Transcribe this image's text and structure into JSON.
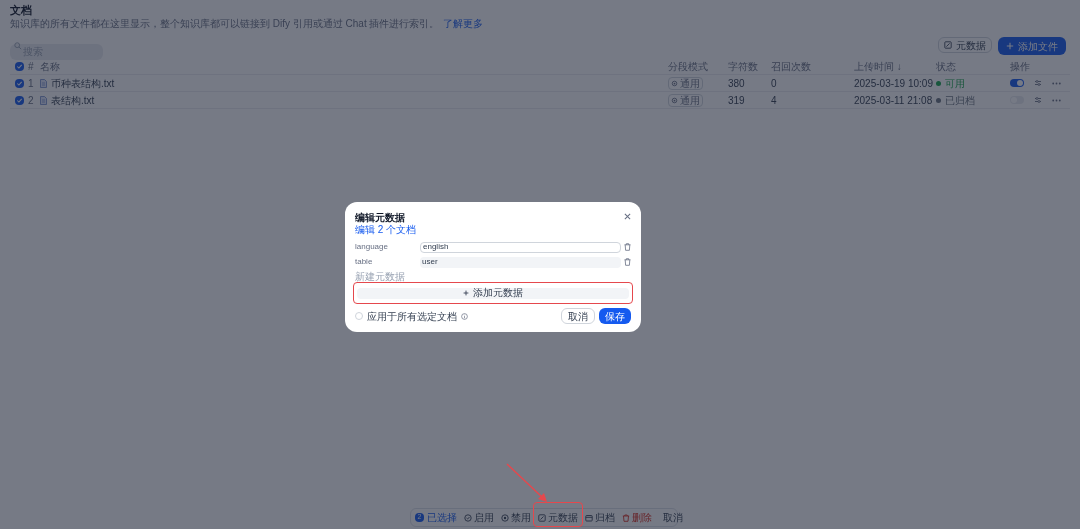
{
  "header": {
    "title": "文档",
    "description": "知识库的所有文件都在这里显示，整个知识库都可以链接到 Dify 引用或通过 Chat 插件进行索引。",
    "learn_more": "了解更多"
  },
  "search": {
    "placeholder": "搜索"
  },
  "toolbar": {
    "metadata_button": "元数据",
    "add_button": "添加文件"
  },
  "table": {
    "all_checked": true,
    "columns": [
      "#",
      "名称",
      "分段模式",
      "字符数",
      "召回次数",
      "上传时间 ↓",
      "状态",
      "操作"
    ],
    "rows": [
      {
        "checked": true,
        "index": "1",
        "name": "币种表结构.txt",
        "mode": "通用",
        "chars": "380",
        "recalls": "0",
        "uploaded": "2025-03-19 10:09",
        "status": "可用",
        "color": "#18563c",
        "enabled": true
      },
      {
        "checked": true,
        "index": "2",
        "name": "表结构.txt",
        "mode": "通用",
        "chars": "319",
        "recalls": "4",
        "uploaded": "2025-03-11 21:08",
        "status": "已归档",
        "color": "#3a4252",
        "enabled": false
      }
    ]
  },
  "modal": {
    "title": "编辑元数据",
    "subtitle": "编辑 2 个文档",
    "fields": [
      {
        "key": "language",
        "value": "english",
        "focused": true
      },
      {
        "key": "table",
        "value": "user",
        "focused": false
      }
    ],
    "new_label": "新建元数据",
    "add_button": "添加元数据",
    "apply_all": {
      "label": "应用于所有选定文档",
      "checked": false
    },
    "cancel": "取消",
    "save": "保存"
  },
  "selection_bar": {
    "count": "2",
    "selected_label": "已选择",
    "actions": [
      {
        "kind": "enable",
        "label": "启用"
      },
      {
        "kind": "disable",
        "label": "禁用"
      },
      {
        "kind": "metadata",
        "label": "元数据"
      },
      {
        "kind": "archive",
        "label": "归档"
      },
      {
        "kind": "delete",
        "label": "删除"
      },
      {
        "kind": "cancel",
        "label": "取消"
      }
    ]
  }
}
